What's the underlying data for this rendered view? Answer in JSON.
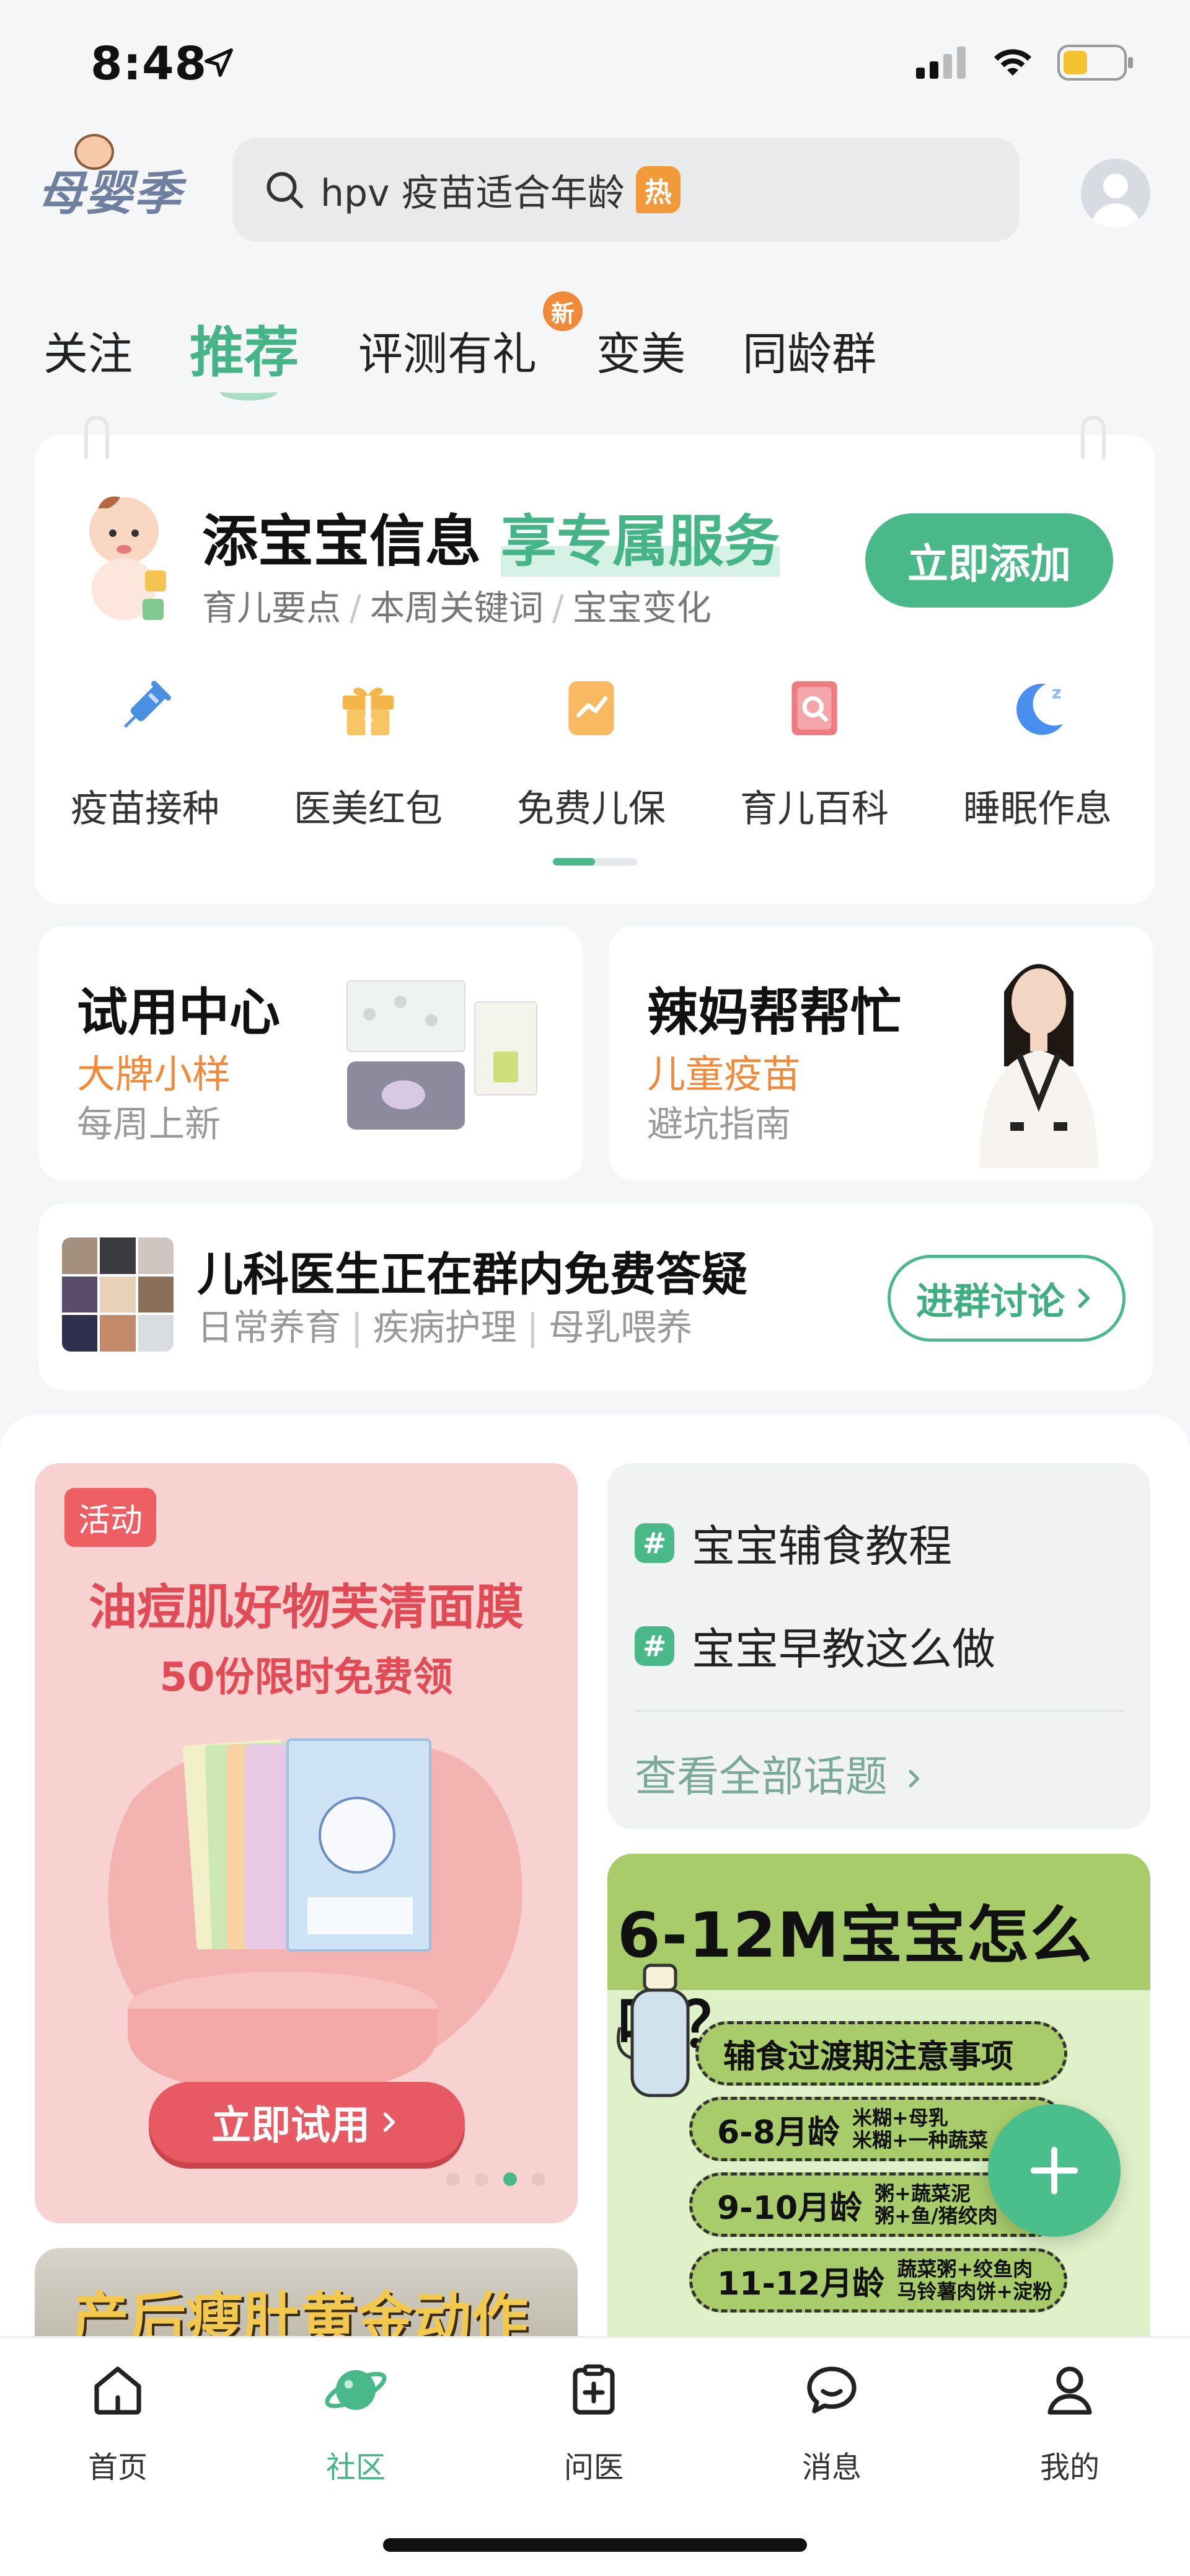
{
  "status_bar": {
    "time": "8:48"
  },
  "header": {
    "logo_text": "母婴季",
    "search": {
      "query": "hpv 疫苗适合年龄",
      "hot_badge": "热"
    }
  },
  "top_tabs": [
    {
      "label": "关注"
    },
    {
      "label": "推荐",
      "active": true
    },
    {
      "label": "评测有礼",
      "badge": "新"
    },
    {
      "label": "变美"
    },
    {
      "label": "同龄群"
    }
  ],
  "baby_card": {
    "title": "添宝宝信息",
    "title_accent": "享专属服务",
    "subtitle_items": [
      "育儿要点",
      "本周关键词",
      "宝宝变化"
    ],
    "button": "立即添加",
    "services": [
      {
        "label": "疫苗接种",
        "icon": "syringe-icon"
      },
      {
        "label": "医美红包",
        "icon": "gift-icon"
      },
      {
        "label": "免费儿保",
        "icon": "clipboard-chart-icon"
      },
      {
        "label": "育儿百科",
        "icon": "book-search-icon"
      },
      {
        "label": "睡眠作息",
        "icon": "moon-sleep-icon"
      }
    ]
  },
  "trial_card": {
    "title": "试用中心",
    "highlight": "大牌小样",
    "note": "每周上新"
  },
  "help_card": {
    "title": "辣妈帮帮忙",
    "highlight": "儿童疫苗",
    "note": "避坑指南"
  },
  "group_card": {
    "title": "儿科医生正在群内免费答疑",
    "tags": [
      "日常养育",
      "疾病护理",
      "母乳喂养"
    ],
    "button": "进群讨论"
  },
  "promo": {
    "tag": "活动",
    "title": "油痘肌好物芙清面膜",
    "subtitle": "50份限时免费领",
    "button": "立即试用",
    "carousel_active_index": 3,
    "carousel_count": 4
  },
  "topics": {
    "items": [
      "宝宝辅食教程",
      "宝宝早教这么做"
    ],
    "more": "查看全部话题"
  },
  "food_post": {
    "title": "6-12M宝宝怎么吃？",
    "rows": [
      {
        "age": "辅食过渡期注意事项",
        "detail": ""
      },
      {
        "age": "6-8月龄",
        "detail": "米糊+母乳\n米糊+一种蔬菜"
      },
      {
        "age": "9-10月龄",
        "detail": "粥+蔬菜泥\n粥+鱼/猪绞肉"
      },
      {
        "age": "11-12月龄",
        "detail": "蔬菜粥+绞鱼肉\n马铃薯肉饼+淀粉"
      }
    ]
  },
  "video_post": {
    "title": "产后瘦肚黄金动作"
  },
  "tabbar": [
    {
      "label": "首页",
      "icon": "home-icon"
    },
    {
      "label": "社区",
      "icon": "planet-icon",
      "active": true
    },
    {
      "label": "问医",
      "icon": "medical-clipboard-icon"
    },
    {
      "label": "消息",
      "icon": "chat-bubble-icon"
    },
    {
      "label": "我的",
      "icon": "person-icon"
    }
  ],
  "colors": {
    "accent": "#49b98a",
    "orange": "#f08a3a",
    "promo_red": "#e14b56"
  }
}
